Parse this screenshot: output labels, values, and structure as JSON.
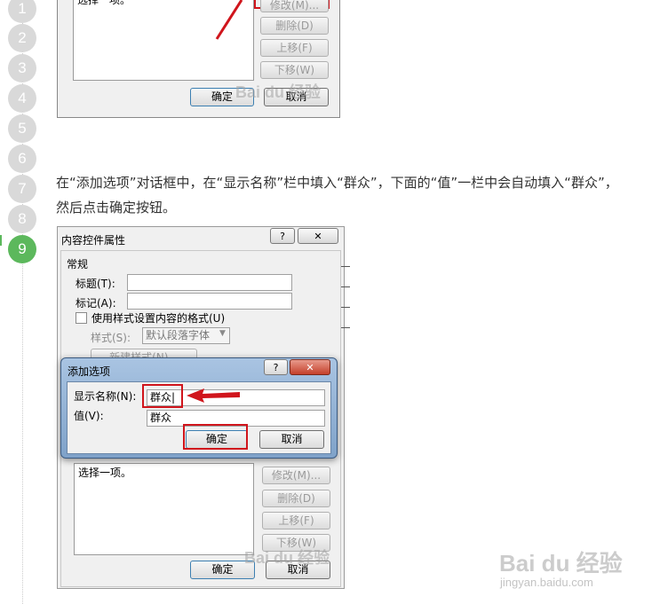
{
  "steps": [
    "1",
    "2",
    "3",
    "4",
    "5",
    "6",
    "7",
    "8",
    "9"
  ],
  "instruction": "在“添加选项”对话框中，在“显示名称”栏中填入“群众”，下面的“值”一栏中会自动填入“群众”，然后点击确定按钮。",
  "top_dialog": {
    "list_text": "选择一项。",
    "modify_label": "修改(M)...",
    "delete_label": "删除(D)",
    "moveup_label": "上移(F)",
    "movedown_label": "下移(W)",
    "ok_label": "确定",
    "cancel_label": "取消"
  },
  "main_dialog": {
    "title": "内容控件属性",
    "help_glyph": "?",
    "close_glyph": "✕",
    "section_general": "常规",
    "title_label": "标题(T):",
    "tag_label": "标记(A):",
    "use_style_label": "使用样式设置内容的格式(U)",
    "style_label": "样式(S):",
    "style_value": "默认段落字体",
    "new_style_label": "新建样式(N)...",
    "list_text": "选择一项。",
    "modify_label": "修改(M)...",
    "delete_label": "删除(D)",
    "moveup_label": "上移(F)",
    "movedown_label": "下移(W)",
    "ok_label": "确定",
    "cancel_label": "取消"
  },
  "add_dialog": {
    "title": "添加选项",
    "help_glyph": "?",
    "close_glyph": "✕",
    "display_name_label": "显示名称(N):",
    "display_name_value": "群众|",
    "value_label": "值(V):",
    "value_value": "群众",
    "ok_label": "确定",
    "cancel_label": "取消"
  },
  "watermark": {
    "brand": "Bai du 经验",
    "url": "jingyan.baidu.com"
  },
  "colors": {
    "highlight": "#d0151c",
    "active_step": "#5cb85c",
    "inactive_step": "#d9d9d9",
    "dialog_frame": "#6f8fb4"
  }
}
